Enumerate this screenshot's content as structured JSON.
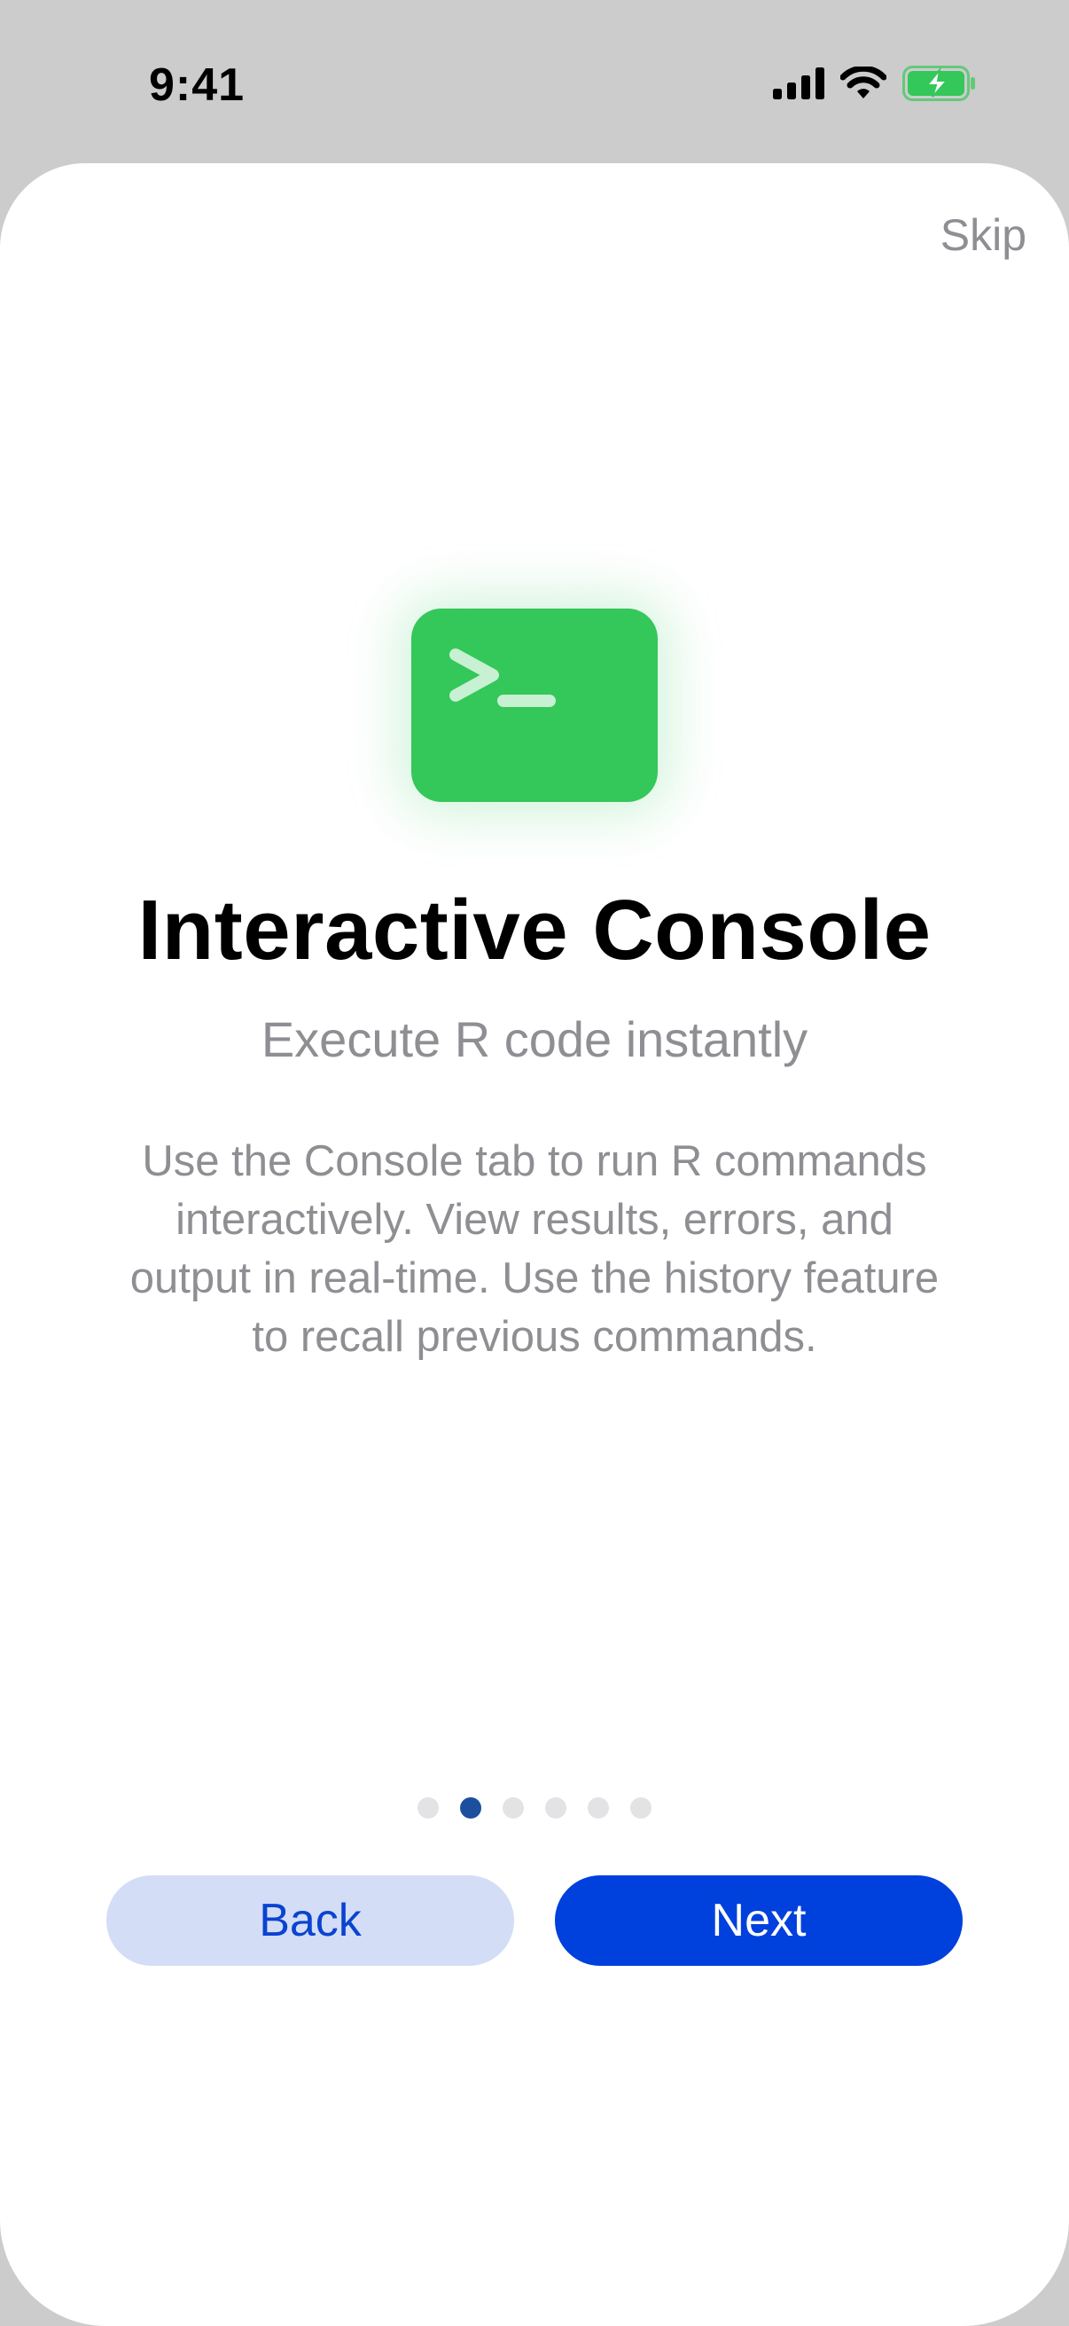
{
  "status_bar": {
    "time": "9:41",
    "icons": [
      "cellular-signal-icon",
      "wifi-icon",
      "battery-charging-icon"
    ],
    "battery_color": "#34c759"
  },
  "onboarding": {
    "skip_label": "Skip",
    "icon": "terminal-prompt-icon",
    "icon_color": "#34c759",
    "title": "Interactive Console",
    "subtitle": "Execute R code instantly",
    "description": "Use the Console tab to run R commands interactively. View results, errors, and output in real-time. Use the history feature to recall previous commands.",
    "page_count": 6,
    "current_page": 2,
    "active_dot_color": "#1c4f9e"
  },
  "buttons": {
    "back_label": "Back",
    "next_label": "Next",
    "next_color": "#0040dd",
    "back_color": "#d3ddf6"
  }
}
